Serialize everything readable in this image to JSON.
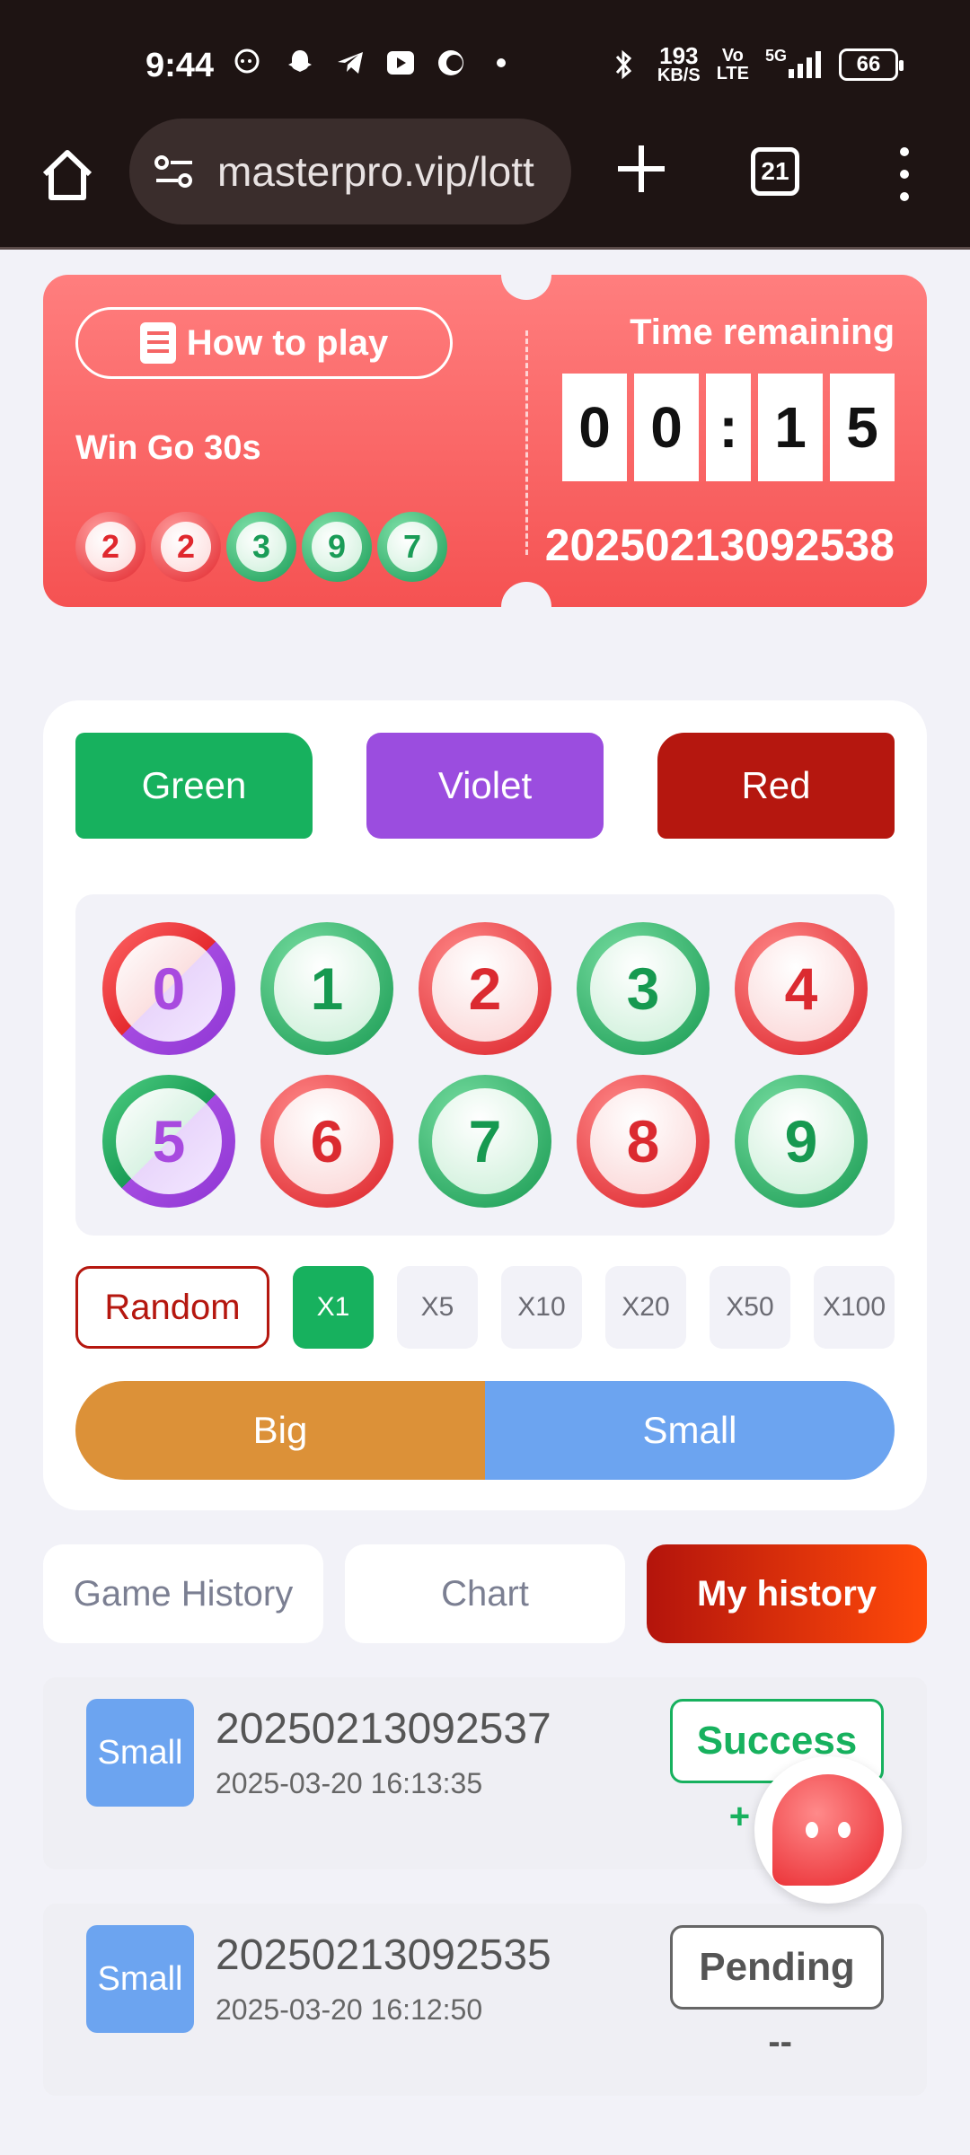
{
  "status_bar": {
    "time": "9:44",
    "speed_value": "193",
    "speed_unit": "KB/S",
    "network_vo": "Vo",
    "network_lte": "LTE",
    "network_5g": "5G",
    "battery": "66"
  },
  "browser": {
    "url": "masterpro.vip/lott",
    "tab_count": "21"
  },
  "game": {
    "how_to_play": "How to play",
    "name": "Win Go 30s",
    "recent_results": [
      {
        "value": "2",
        "color": "red"
      },
      {
        "value": "2",
        "color": "red"
      },
      {
        "value": "3",
        "color": "green"
      },
      {
        "value": "9",
        "color": "green"
      },
      {
        "value": "7",
        "color": "green"
      }
    ],
    "time_label": "Time remaining",
    "countdown": [
      "0",
      "0",
      ":",
      "1",
      "5"
    ],
    "period_id": "20250213092538"
  },
  "bet_panel": {
    "colors": [
      {
        "label": "Green",
        "color": "#17b15e"
      },
      {
        "label": "Violet",
        "color": "#9b4ddf"
      },
      {
        "label": "Red",
        "color": "#b5170f"
      }
    ],
    "numbers": [
      {
        "value": "0",
        "style": "redviolet"
      },
      {
        "value": "1",
        "style": "green"
      },
      {
        "value": "2",
        "style": "red"
      },
      {
        "value": "3",
        "style": "green"
      },
      {
        "value": "4",
        "style": "red"
      },
      {
        "value": "5",
        "style": "greenviolet"
      },
      {
        "value": "6",
        "style": "red"
      },
      {
        "value": "7",
        "style": "green"
      },
      {
        "value": "8",
        "style": "red"
      },
      {
        "value": "9",
        "style": "green"
      }
    ],
    "random_label": "Random",
    "multipliers": [
      "X1",
      "X5",
      "X10",
      "X20",
      "X50",
      "X100"
    ],
    "active_multiplier": "X1",
    "big_label": "Big",
    "small_label": "Small"
  },
  "tabs": [
    {
      "label": "Game History",
      "active": false
    },
    {
      "label": "Chart",
      "active": false
    },
    {
      "label": "My history",
      "active": true
    }
  ],
  "history": [
    {
      "size": "Small",
      "period": "20250213092537",
      "datetime": "2025-03-20 16:13:35",
      "status": "Success",
      "amount": "+ ₹"
    },
    {
      "size": "Small",
      "period": "20250213092535",
      "datetime": "2025-03-20 16:12:50",
      "status": "Pending",
      "amount": "--"
    }
  ]
}
